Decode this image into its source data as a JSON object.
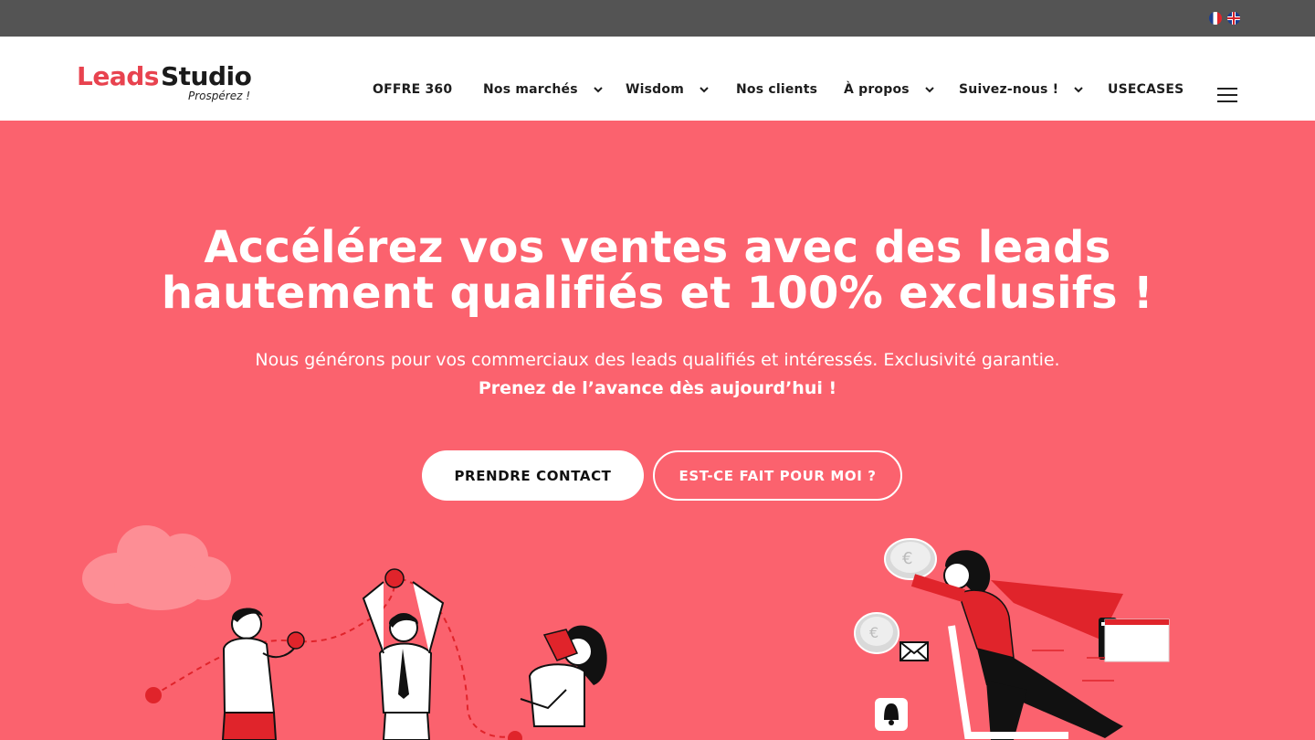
{
  "topbar": {
    "languages": [
      {
        "code": "fr",
        "icon": "france-flag-icon"
      },
      {
        "code": "en",
        "icon": "uk-flag-icon"
      }
    ]
  },
  "header": {
    "logo": {
      "part1": "Leads",
      "part2": "Studio",
      "tagline": "Prospérez !"
    },
    "nav": [
      {
        "label": "OFFRE 360",
        "dropdown": false
      },
      {
        "label": "Nos marchés",
        "dropdown": true
      },
      {
        "label": "Wisdom",
        "dropdown": true
      },
      {
        "label": "Nos clients",
        "dropdown": false
      },
      {
        "label": "À propos",
        "dropdown": true
      },
      {
        "label": "Suivez-nous !",
        "dropdown": true
      },
      {
        "label": "USECASES",
        "dropdown": false
      }
    ],
    "menu_icon": "hamburger-menu-icon"
  },
  "hero": {
    "title_line1": "Accélérez vos ventes avec des leads",
    "title_line2": "hautement qualifiés et 100% exclusifs !",
    "subtitle": "Nous générons pour vos commerciaux des leads qualifiés et intéressés. Exclusivité garantie.",
    "subtitle_bold": "Prenez de l’avance dès aujourd’hui !",
    "cta_primary": "PRENDRE CONTACT",
    "cta_secondary": "EST-CE FAIT POUR MOI ?"
  },
  "colors": {
    "hero_bg": "#fb626e",
    "topbar_bg": "#545454",
    "brand_red": "#e8434f",
    "illustration_red": "#e0242b"
  }
}
